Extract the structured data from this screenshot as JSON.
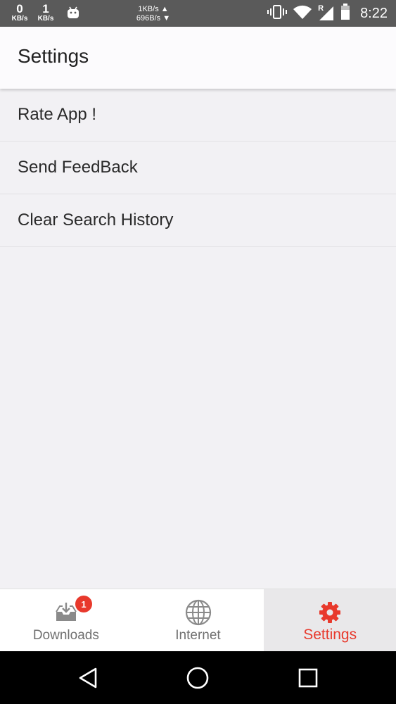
{
  "status_bar": {
    "down_speed": {
      "value": "0",
      "unit": "KB/s"
    },
    "up_speed": {
      "value": "1",
      "unit": "KB/s"
    },
    "net_up": "1KB/s ▲",
    "net_down": "696B/s ▼",
    "time": "8:22",
    "icons": [
      "android-icon",
      "vibrate-icon",
      "wifi-icon",
      "roaming-signal-icon",
      "battery-icon"
    ],
    "roaming_label": "R"
  },
  "app_bar": {
    "title": "Settings"
  },
  "settings_list": [
    {
      "label": "Rate App !"
    },
    {
      "label": "Send FeedBack"
    },
    {
      "label": "Clear Search History"
    }
  ],
  "bottom_nav": {
    "items": [
      {
        "label": "Downloads",
        "icon": "downloads-inbox-icon",
        "badge": "1",
        "active": false
      },
      {
        "label": "Internet",
        "icon": "globe-icon",
        "active": false
      },
      {
        "label": "Settings",
        "icon": "gear-icon",
        "active": true
      }
    ]
  },
  "system_nav": {
    "icons": [
      "back-icon",
      "home-icon",
      "recents-icon"
    ]
  },
  "colors": {
    "accent": "#e8392c",
    "status_bar": "#5a5a5a",
    "background": "#f2f1f4"
  }
}
